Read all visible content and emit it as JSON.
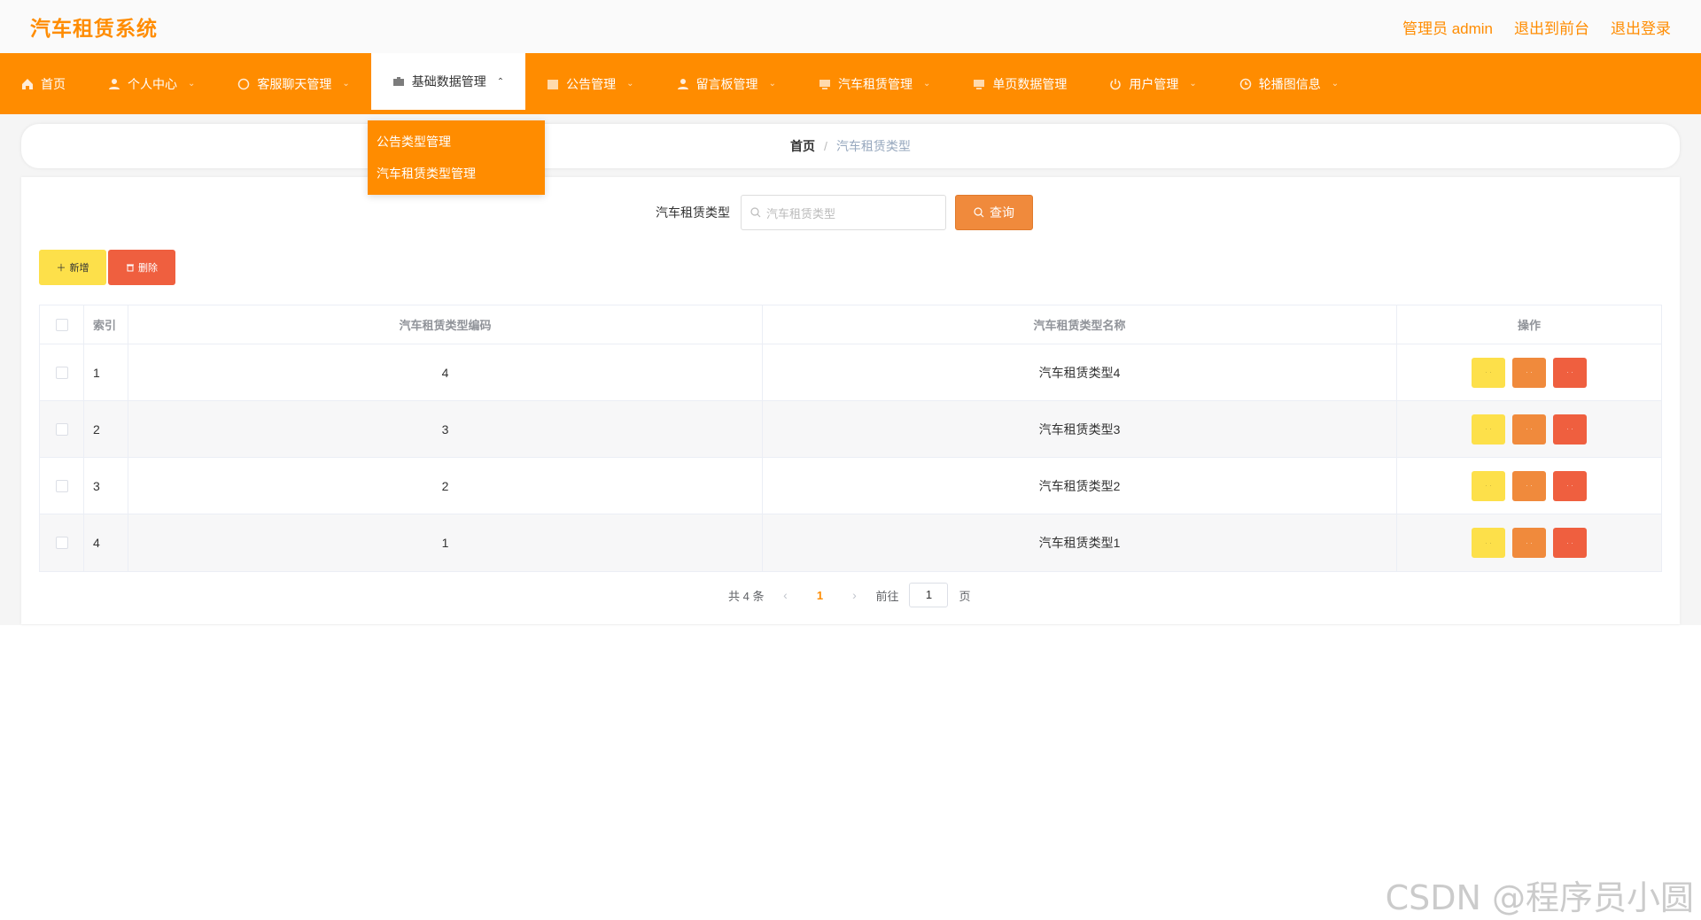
{
  "header": {
    "brand": "汽车租赁系统",
    "links": [
      "管理员 admin",
      "退出到前台",
      "退出登录"
    ]
  },
  "nav": [
    {
      "label": "首页",
      "icon": "home-icon",
      "dropdown": false
    },
    {
      "label": "个人中心",
      "icon": "user-icon",
      "dropdown": true
    },
    {
      "label": "客服聊天管理",
      "icon": "chat-icon",
      "dropdown": true
    },
    {
      "label": "基础数据管理",
      "icon": "briefcase-icon",
      "dropdown": true,
      "active": true
    },
    {
      "label": "公告管理",
      "icon": "calendar-icon",
      "dropdown": true
    },
    {
      "label": "留言板管理",
      "icon": "user-icon",
      "dropdown": true
    },
    {
      "label": "汽车租赁管理",
      "icon": "monitor-icon",
      "dropdown": true
    },
    {
      "label": "单页数据管理",
      "icon": "monitor-icon",
      "dropdown": false
    },
    {
      "label": "用户管理",
      "icon": "power-icon",
      "dropdown": true
    },
    {
      "label": "轮播图信息",
      "icon": "clock-icon",
      "dropdown": true
    }
  ],
  "dropdown": [
    "公告类型管理",
    "汽车租赁类型管理"
  ],
  "breadcrumb": {
    "home": "首页",
    "sep": "/",
    "current": "汽车租赁类型"
  },
  "search": {
    "label": "汽车租赁类型",
    "placeholder": "汽车租赁类型",
    "button": "查询"
  },
  "actions": {
    "add": "新增",
    "delete": "删除"
  },
  "table": {
    "headers": [
      "索引",
      "汽车租赁类型编码",
      "汽车租赁类型名称",
      "操作"
    ],
    "rows": [
      {
        "index": "1",
        "code": "4",
        "name": "汽车租赁类型4"
      },
      {
        "index": "2",
        "code": "3",
        "name": "汽车租赁类型3"
      },
      {
        "index": "3",
        "code": "2",
        "name": "汽车租赁类型2"
      },
      {
        "index": "4",
        "code": "1",
        "name": "汽车租赁类型1"
      }
    ]
  },
  "pagination": {
    "total": "共 4 条",
    "current": "1",
    "goto": "前往",
    "page_value": "1",
    "page_suffix": "页"
  },
  "watermark": "CSDN @程序员小圆",
  "colors": {
    "accent": "#ff8c00",
    "yellow": "#fde04a",
    "orange": "#f08a3c",
    "red": "#ef5f3f"
  }
}
